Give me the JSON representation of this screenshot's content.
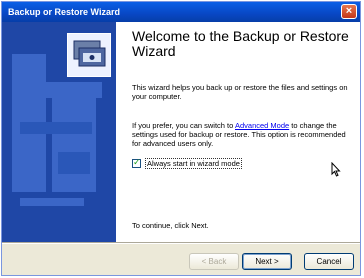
{
  "window": {
    "title": "Backup or Restore Wizard",
    "close_glyph": "×"
  },
  "content": {
    "heading": "Welcome to the Backup or Restore Wizard",
    "paragraph1": "This wizard helps you back up or restore the files and settings on your computer.",
    "paragraph2_before": "If you prefer, you can switch to ",
    "paragraph2_link": "Advanced Mode",
    "paragraph2_after": " to change the settings used for backup or restore. This option is recommended for advanced users only.",
    "checkbox_label": "Always start in wizard mode",
    "checkbox_checked": true,
    "check_glyph": "✓",
    "continue_text": "To continue, click Next."
  },
  "buttons": {
    "back_label": "< Back",
    "next_label": "Next >",
    "cancel_label": "Cancel"
  },
  "icons": [
    "backup-wizard-icon",
    "mouse-pointer-icon",
    "close-icon",
    "checkbox-check-icon"
  ],
  "colors": {
    "titlebar": "#0847c4",
    "sidebar": "#1f47a6",
    "link": "#0000ee",
    "dialog_face": "#ece9d8"
  }
}
